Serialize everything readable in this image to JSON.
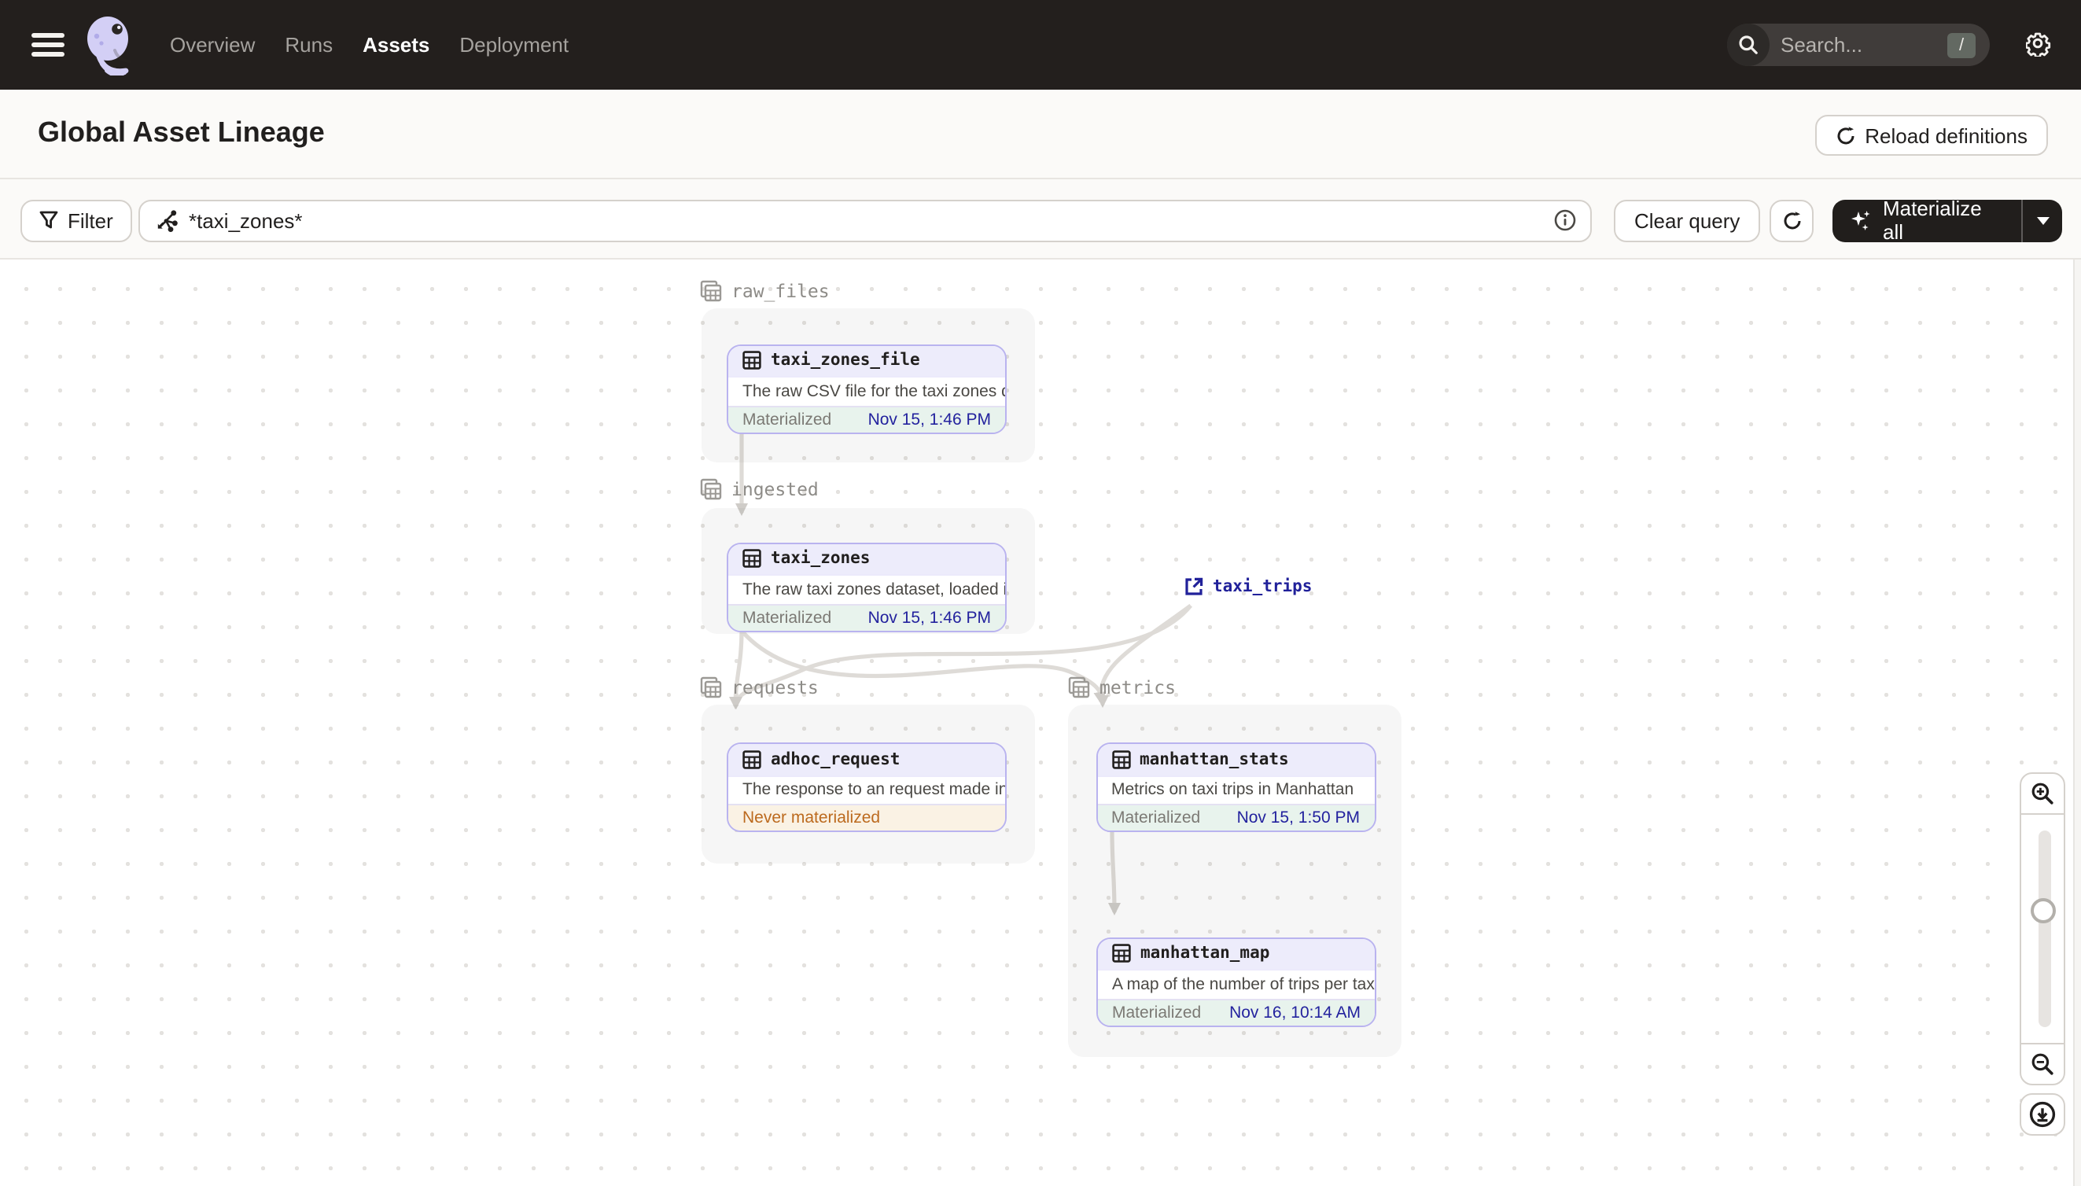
{
  "nav": {
    "items": [
      {
        "label": "Overview",
        "active": false
      },
      {
        "label": "Runs",
        "active": false
      },
      {
        "label": "Assets",
        "active": true
      },
      {
        "label": "Deployment",
        "active": false
      }
    ],
    "search": {
      "placeholder": "Search...",
      "shortcut": "/"
    }
  },
  "header": {
    "title": "Global Asset Lineage",
    "reload_label": "Reload definitions"
  },
  "toolbar": {
    "filter_label": "Filter",
    "query_value": "*taxi_zones*",
    "clear_label": "Clear query",
    "materialize_label": "Materialize all"
  },
  "graph": {
    "groups": [
      {
        "name": "raw_files"
      },
      {
        "name": "ingested"
      },
      {
        "name": "requests"
      },
      {
        "name": "metrics"
      }
    ],
    "nodes": [
      {
        "title": "taxi_zones_file",
        "description": "The raw CSV file for the taxi zones dat...",
        "status": "Materialized",
        "timestamp": "Nov 15, 1:46 PM"
      },
      {
        "title": "taxi_zones",
        "description": "The raw taxi zones dataset, loaded int...",
        "status": "Materialized",
        "timestamp": "Nov 15, 1:46 PM"
      },
      {
        "title": "adhoc_request",
        "description": "The response to an request made in th...",
        "status": "Never materialized",
        "timestamp": ""
      },
      {
        "title": "manhattan_stats",
        "description": "Metrics on taxi trips in Manhattan",
        "status": "Materialized",
        "timestamp": "Nov 15, 1:50 PM"
      },
      {
        "title": "manhattan_map",
        "description": "A map of the number of trips per taxi z...",
        "status": "Materialized",
        "timestamp": "Nov 16, 10:14 AM"
      }
    ],
    "external_assets": [
      {
        "label": "taxi_trips"
      }
    ]
  },
  "colors": {
    "nav_bg": "#231f1d",
    "accent_purple_border": "#b9b3ef",
    "node_header_bg": "#edecfb",
    "materialized_bg": "#e8f3ed",
    "timestamp_text": "#23229e",
    "never_materialized_text": "#bc6a1e",
    "never_materialized_bg": "#faf2e4",
    "external_asset_text": "#21219a"
  }
}
